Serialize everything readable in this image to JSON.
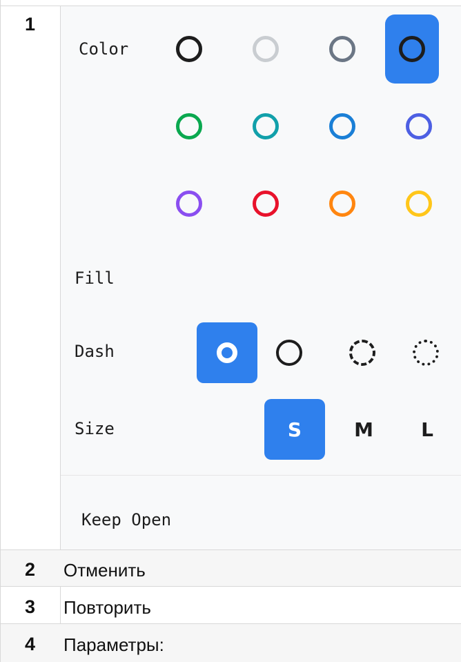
{
  "rows": [
    {
      "num": "1"
    },
    {
      "num": "2",
      "text": "Отменить"
    },
    {
      "num": "3",
      "text": "Повторить"
    },
    {
      "num": "4",
      "text": "Параметры:"
    }
  ],
  "panel": {
    "color_label": "Color",
    "fill_label": "Fill",
    "dash_label": "Dash",
    "size_label": "Size",
    "keep_open_label": "Keep Open",
    "colors": [
      {
        "name": "black",
        "hex": "#1d1d1d",
        "selected": false
      },
      {
        "name": "grey-light",
        "hex": "#c9cdd1",
        "selected": false
      },
      {
        "name": "grey",
        "hex": "#6b7685",
        "selected": false
      },
      {
        "name": "black-selected",
        "hex": "#1d1d1d",
        "selected": true
      },
      {
        "name": "green",
        "hex": "#0aa84f",
        "selected": false
      },
      {
        "name": "teal",
        "hex": "#12a0aa",
        "selected": false
      },
      {
        "name": "blue",
        "hex": "#1a7fd6",
        "selected": false
      },
      {
        "name": "indigo",
        "hex": "#4d5fe3",
        "selected": false
      },
      {
        "name": "violet",
        "hex": "#8a4ef0",
        "selected": false
      },
      {
        "name": "red",
        "hex": "#e8122b",
        "selected": false
      },
      {
        "name": "orange",
        "hex": "#ff8610",
        "selected": false
      },
      {
        "name": "yellow",
        "hex": "#ffc61a",
        "selected": false
      }
    ],
    "dash_styles": [
      "draw",
      "solid",
      "dashed",
      "dotted"
    ],
    "sizes": [
      "S",
      "M",
      "L"
    ],
    "selected_size": "S",
    "accent": "#2f80ed"
  }
}
